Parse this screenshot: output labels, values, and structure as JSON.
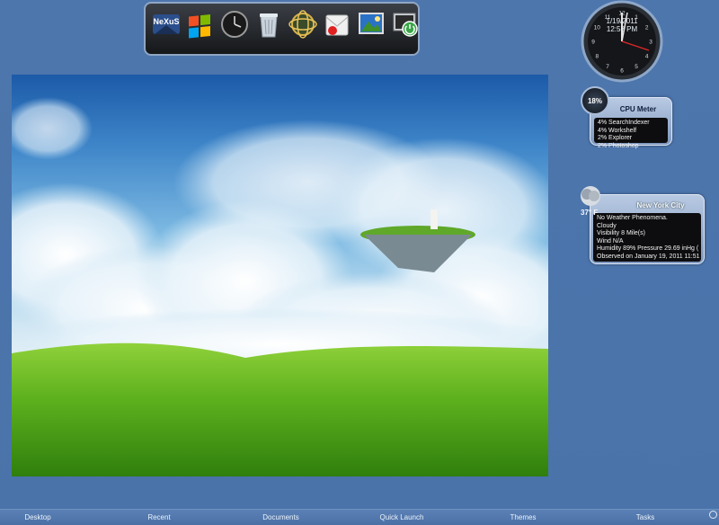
{
  "dock": {
    "items": [
      {
        "name": "nexus-logo-icon",
        "label": "NeXuS"
      },
      {
        "name": "windows-logo-icon"
      },
      {
        "name": "clock-icon"
      },
      {
        "name": "recycle-bin-icon"
      },
      {
        "name": "network-globe-icon"
      },
      {
        "name": "mail-icon"
      },
      {
        "name": "photo-viewer-icon"
      },
      {
        "name": "monitor-power-icon"
      }
    ]
  },
  "clock": {
    "date": "1/19/2011",
    "time": "12:58 PM",
    "numerals": [
      "12",
      "1",
      "2",
      "3",
      "4",
      "5",
      "6",
      "7",
      "8",
      "9",
      "10",
      "11"
    ]
  },
  "cpu_meter": {
    "percent": "18%",
    "title": "CPU Meter",
    "processes": [
      "4% SearchIndexer",
      "4% Workshelf",
      "2% Explorer",
      "2% Photoshop"
    ]
  },
  "weather": {
    "city": "New York City",
    "temp": "37° F",
    "lines": [
      "No Weather Phenomena.",
      "Cloudy",
      "Visibility 8 Mile(s)",
      "Wind N/A",
      "Humidity 89%     Pressure 29.69 inHg (",
      "Observed on January 19, 2011 11:51"
    ]
  },
  "taskbar": {
    "items": [
      "Desktop",
      "Recent",
      "Documents",
      "Quick Launch",
      "Themes",
      "Tasks"
    ]
  },
  "colors": {
    "desktop": "#4a73aa",
    "dock": "#1c1e21",
    "panel": "#9ab0d2"
  }
}
